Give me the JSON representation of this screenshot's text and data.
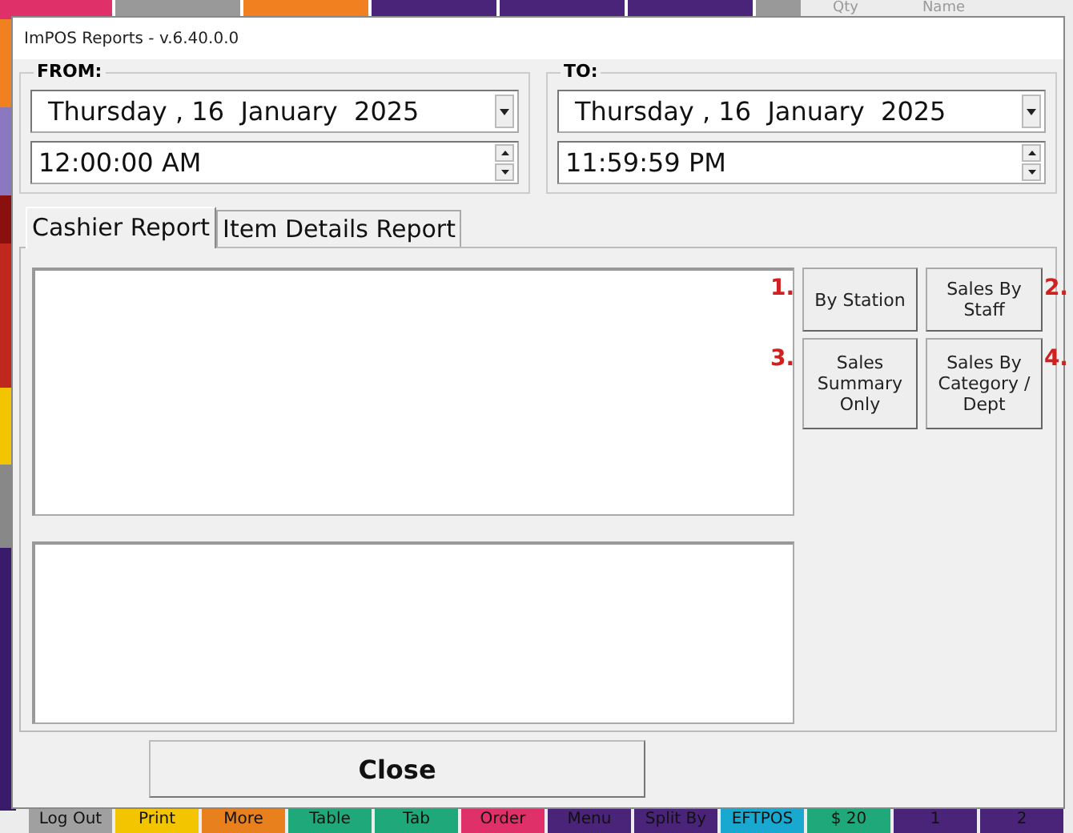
{
  "background": {
    "order_columns": [
      "Qty",
      "Name"
    ],
    "pos_buttons": [
      {
        "label": "Log Out",
        "color": "#a0a0a0"
      },
      {
        "label": "Print",
        "color": "#f2c500"
      },
      {
        "label": "More",
        "color": "#e8801e"
      },
      {
        "label": "Table",
        "color": "#1fa87a"
      },
      {
        "label": "Tab",
        "color": "#1fa87a"
      },
      {
        "label": "Order",
        "color": "#e0306a"
      },
      {
        "label": "Menu",
        "color": "#4a2478"
      },
      {
        "label": "Split By",
        "color": "#4a2478"
      },
      {
        "label": "EFTPOS",
        "color": "#19a8d0"
      },
      {
        "label": "$ 20",
        "color": "#1fa87a"
      },
      {
        "label": "1",
        "color": "#4a2478"
      },
      {
        "label": "2",
        "color": "#4a2478"
      }
    ]
  },
  "window": {
    "title": "ImPOS Reports - v.6.40.0.0"
  },
  "ranges": [
    {
      "label": "FROM:",
      "date": "Thursday , 16  January  2025",
      "time": "12:00:00 AM"
    },
    {
      "label": "TO:",
      "date": "Thursday , 16  January  2025",
      "time": "11:59:59 PM"
    }
  ],
  "tabs": [
    {
      "label": "Cashier Report",
      "selected": true
    },
    {
      "label": "Item Details Report",
      "selected": false
    }
  ],
  "report_buttons": [
    {
      "number": "1.",
      "label": "By Station"
    },
    {
      "number": "2.",
      "label": "Sales By Staff"
    },
    {
      "number": "3.",
      "label": "Sales Summary Only"
    },
    {
      "number": "4.",
      "label": "Sales By Category / Dept"
    }
  ],
  "close_button": "Close"
}
